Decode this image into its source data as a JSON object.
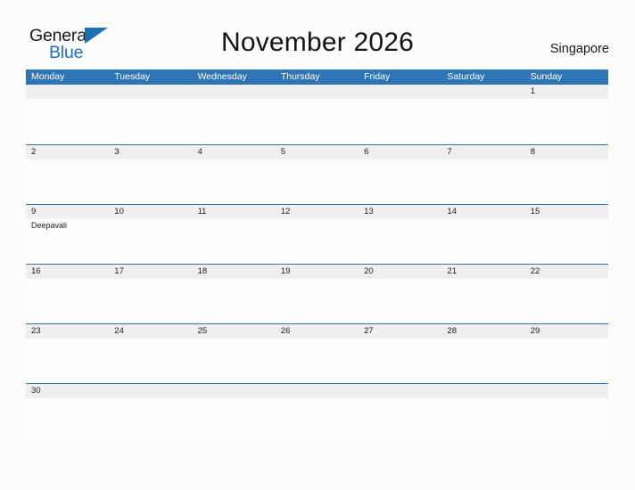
{
  "brand": {
    "name_part1": "General",
    "name_part2": "Blue",
    "flag_icon": "flag-triangle-icon",
    "accent_color": "#1f6fb5"
  },
  "header": {
    "title": "November 2026",
    "locale": "Singapore"
  },
  "calendar": {
    "header_bg": "#2e75b6",
    "number_band_bg": "#efefef",
    "row_divider_color": "#2e75b6",
    "day_headers": [
      "Monday",
      "Tuesday",
      "Wednesday",
      "Thursday",
      "Friday",
      "Saturday",
      "Sunday"
    ],
    "weeks": [
      {
        "days": [
          {
            "num": "",
            "events": []
          },
          {
            "num": "",
            "events": []
          },
          {
            "num": "",
            "events": []
          },
          {
            "num": "",
            "events": []
          },
          {
            "num": "",
            "events": []
          },
          {
            "num": "",
            "events": []
          },
          {
            "num": "1",
            "events": []
          }
        ]
      },
      {
        "days": [
          {
            "num": "2",
            "events": []
          },
          {
            "num": "3",
            "events": []
          },
          {
            "num": "4",
            "events": []
          },
          {
            "num": "5",
            "events": []
          },
          {
            "num": "6",
            "events": []
          },
          {
            "num": "7",
            "events": []
          },
          {
            "num": "8",
            "events": []
          }
        ]
      },
      {
        "days": [
          {
            "num": "9",
            "events": [
              "Deepavali"
            ]
          },
          {
            "num": "10",
            "events": []
          },
          {
            "num": "11",
            "events": []
          },
          {
            "num": "12",
            "events": []
          },
          {
            "num": "13",
            "events": []
          },
          {
            "num": "14",
            "events": []
          },
          {
            "num": "15",
            "events": []
          }
        ]
      },
      {
        "days": [
          {
            "num": "16",
            "events": []
          },
          {
            "num": "17",
            "events": []
          },
          {
            "num": "18",
            "events": []
          },
          {
            "num": "19",
            "events": []
          },
          {
            "num": "20",
            "events": []
          },
          {
            "num": "21",
            "events": []
          },
          {
            "num": "22",
            "events": []
          }
        ]
      },
      {
        "days": [
          {
            "num": "23",
            "events": []
          },
          {
            "num": "24",
            "events": []
          },
          {
            "num": "25",
            "events": []
          },
          {
            "num": "26",
            "events": []
          },
          {
            "num": "27",
            "events": []
          },
          {
            "num": "28",
            "events": []
          },
          {
            "num": "29",
            "events": []
          }
        ]
      },
      {
        "days": [
          {
            "num": "30",
            "events": []
          },
          {
            "num": "",
            "events": []
          },
          {
            "num": "",
            "events": []
          },
          {
            "num": "",
            "events": []
          },
          {
            "num": "",
            "events": []
          },
          {
            "num": "",
            "events": []
          },
          {
            "num": "",
            "events": []
          }
        ]
      }
    ]
  }
}
